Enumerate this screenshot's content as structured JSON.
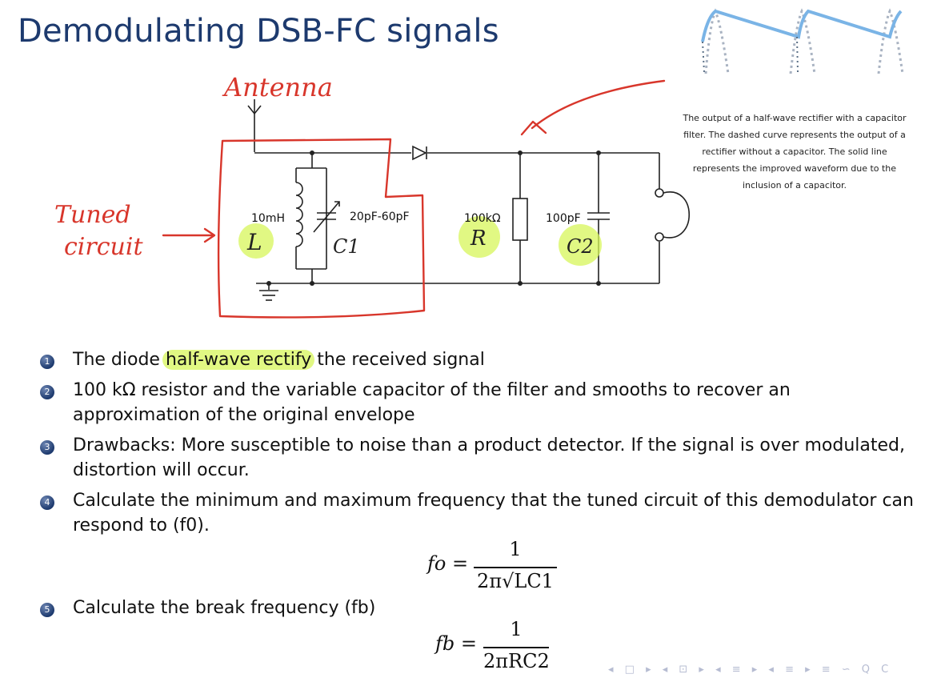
{
  "slide": {
    "title": "Demodulating DSB-FC signals"
  },
  "circuit": {
    "annotation_antenna": "Antenna",
    "annotation_tuned": [
      "Tuned",
      "circuit"
    ],
    "label_inductor": "10mH",
    "label_varcap": "20pF-60pF",
    "label_resistor": "100kΩ",
    "label_capacitor": "100pF",
    "symbol_L": "L",
    "symbol_C1": "C1",
    "symbol_R": "R",
    "symbol_C2": "C2"
  },
  "inset": {
    "caption": "The output of a half-wave rectifier with a capacitor filter. The dashed curve represents the output of a rectifier without a capacitor. The solid line represents the improved waveform due to the inclusion of a capacitor."
  },
  "points": [
    {
      "num": "1",
      "pre": "The diode ",
      "highlight": "half-wave rectify",
      "post": " the received signal"
    },
    {
      "num": "2",
      "text": "100 kΩ resistor and the variable capacitor of the filter and smooths to recover an approximation of the original envelope"
    },
    {
      "num": "3",
      "text": "Drawbacks: More susceptible to noise than a product detector. If the signal is over modulated, distortion will occur."
    },
    {
      "num": "4",
      "text": "Calculate the minimum and maximum frequency that the tuned circuit of this demodulator can respond to (f0)."
    },
    {
      "num": "5",
      "text": "Calculate the break frequency (fb)"
    }
  ],
  "formulas": {
    "f0": {
      "lhs": "fo =",
      "numerator": "1",
      "denominator": "2π√LC1"
    },
    "fb": {
      "lhs": "fb =",
      "numerator": "1",
      "denominator": "2πRC2"
    }
  },
  "nav": {
    "symbols": "◂ □ ▸ ◂ ⊡ ▸ ◂ ≡ ▸ ◂ ≡ ▸   ≡   ∽ Q C"
  },
  "colors": {
    "title": "#1d3a6e",
    "annotation_red": "#d8362b",
    "highlight": "#d7f55a",
    "waveform_blue": "#7ab4e6"
  }
}
